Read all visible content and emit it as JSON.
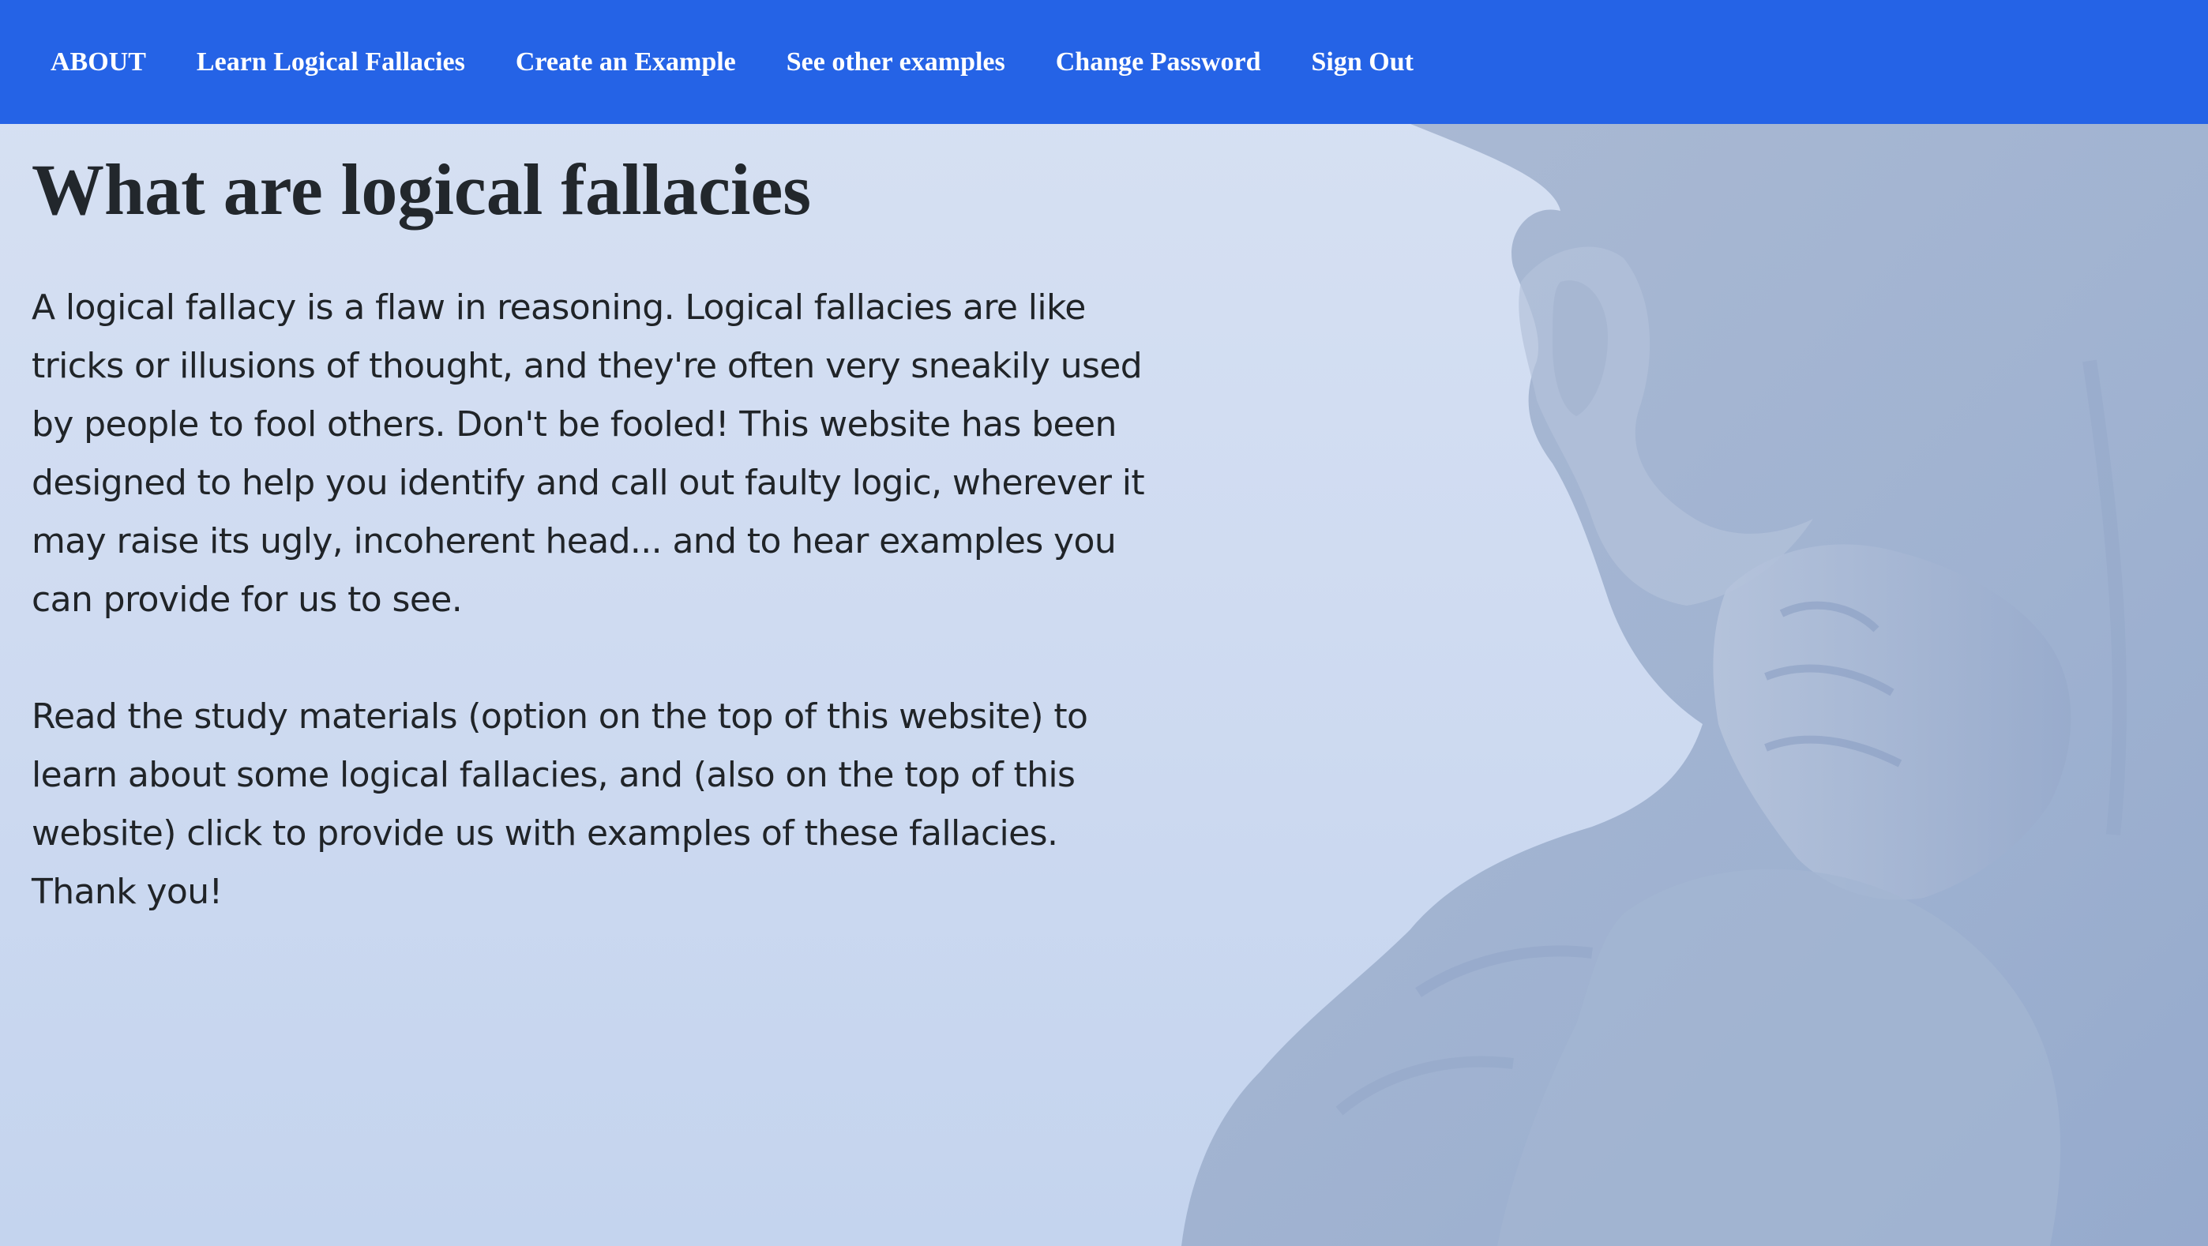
{
  "nav": {
    "items": [
      {
        "label": "ABOUT"
      },
      {
        "label": "Learn Logical Fallacies"
      },
      {
        "label": "Create an Example"
      },
      {
        "label": "See other examples"
      },
      {
        "label": "Change Password"
      },
      {
        "label": "Sign Out"
      }
    ]
  },
  "main": {
    "title": "What are logical fallacies",
    "paragraphs": [
      "A logical fallacy is a flaw in reasoning. Logical fallacies are like tricks or illusions of thought, and they're often very sneakily used by people to fool others. Don't be fooled! This website has been designed to help you identify and call out faulty logic, wherever it may raise its ugly, incoherent head... and to hear examples you can provide for us to see.",
      "Read the study materials (option on the top of this website) to learn about some logical fallacies, and (also on the top of this website) click to provide us with examples of these fallacies. Thank you!"
    ]
  },
  "colors": {
    "nav_background": "#2563e6",
    "page_background": "#d3def2",
    "text": "#202428"
  },
  "background_image": {
    "icon": "thinker-statue-image"
  }
}
